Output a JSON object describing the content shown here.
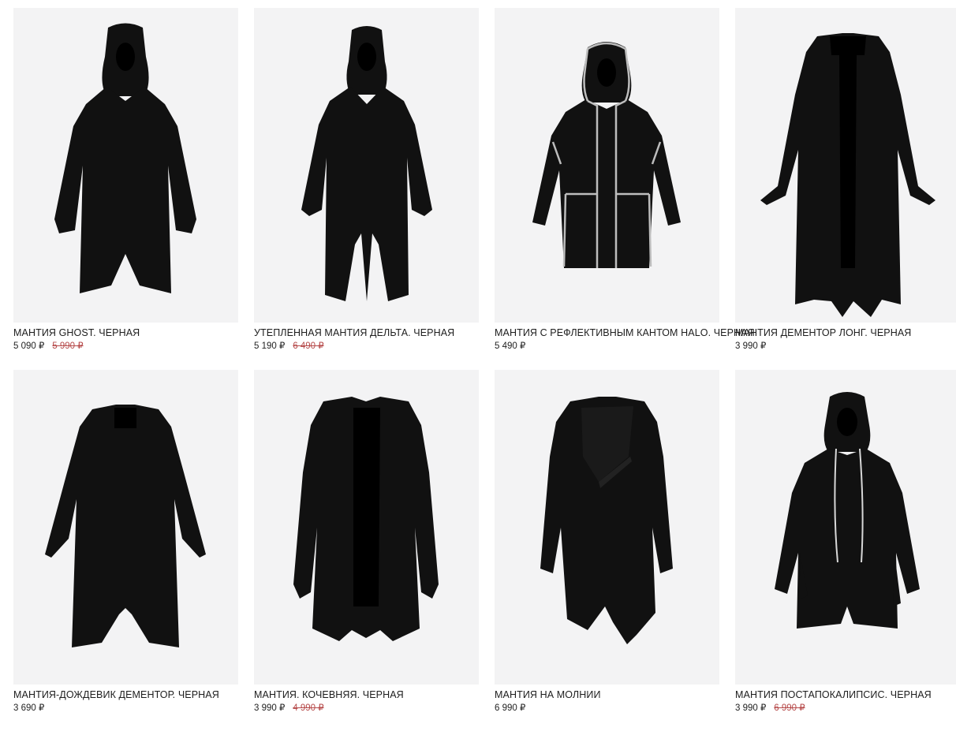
{
  "products": [
    {
      "name": "МАНТИЯ GHOST. ЧЕРНАЯ",
      "price": "5 090 ₽",
      "old_price": "5 990 ₽"
    },
    {
      "name": "УТЕПЛЕННАЯ МАНТИЯ ДЕЛЬТА. ЧЕРНАЯ",
      "price": "5 190 ₽",
      "old_price": "6 490 ₽"
    },
    {
      "name": "МАНТИЯ С РЕФЛЕКТИВНЫМ КАНТОМ HALO. ЧЕРНАЯ",
      "price": "5 490 ₽",
      "old_price": ""
    },
    {
      "name": "МАНТИЯ ДЕМЕНТОР ЛОНГ. ЧЕРНАЯ",
      "price": "3 990 ₽",
      "old_price": ""
    },
    {
      "name": "МАНТИЯ-ДОЖДЕВИК ДЕМЕНТОР. ЧЕРНАЯ",
      "price": "3 690 ₽",
      "old_price": ""
    },
    {
      "name": "МАНТИЯ. КОЧЕВНЯЯ. ЧЕРНАЯ",
      "price": "3 990 ₽",
      "old_price": "4 990 ₽"
    },
    {
      "name": "МАНТИЯ НА МОЛНИИ",
      "price": "6 990 ₽",
      "old_price": ""
    },
    {
      "name": "МАНТИЯ ПОСТАПОКАЛИПСИС. ЧЕРНАЯ",
      "price": "3 990 ₽",
      "old_price": "6 990 ₽"
    }
  ],
  "colors": {
    "card_bg": "#f3f3f4",
    "garment": "#111111",
    "old_price": "#b64a4a",
    "reflective_trim": "#bdbdbd"
  },
  "icons": [
    "hooded-robe-icon",
    "hooded-robe-icon",
    "reflective-hooded-coat-icon",
    "long-cardigan-icon",
    "drape-raincoat-icon",
    "shawl-collar-coat-icon",
    "asymmetric-zip-coat-icon",
    "drawstring-hoodie-coat-icon"
  ]
}
